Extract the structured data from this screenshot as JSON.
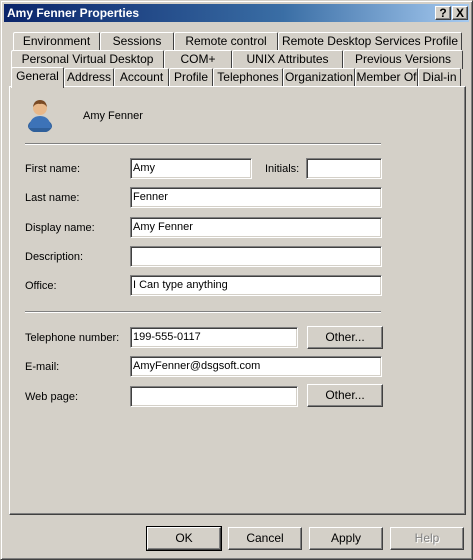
{
  "window": {
    "title": "Amy Fenner Properties",
    "help_button": "?",
    "close_button": "X"
  },
  "tabs": {
    "row1": [
      "Environment",
      "Sessions",
      "Remote control",
      "Remote Desktop Services Profile"
    ],
    "row2": [
      "Personal Virtual Desktop",
      "COM+",
      "UNIX Attributes",
      "Previous Versions"
    ],
    "row3": [
      "General",
      "Address",
      "Account",
      "Profile",
      "Telephones",
      "Organization",
      "Member Of",
      "Dial-in"
    ],
    "active": "General"
  },
  "general": {
    "user_icon": "user-icon",
    "display_heading": "Amy Fenner",
    "first_name_label": "First name:",
    "first_name": "Amy",
    "initials_label": "Initials:",
    "initials": "",
    "last_name_label": "Last name:",
    "last_name": "Fenner",
    "display_name_label": "Display name:",
    "display_name": "Amy Fenner",
    "description_label": "Description:",
    "description": "",
    "office_label": "Office:",
    "office": "I Can type anything",
    "telephone_label": "Telephone number:",
    "telephone": "199-555-0117",
    "email_label": "E-mail:",
    "email": "AmyFenner@dsgsoft.com",
    "webpage_label": "Web page:",
    "webpage": "",
    "other_button": "Other..."
  },
  "footer": {
    "ok": "OK",
    "cancel": "Cancel",
    "apply": "Apply",
    "help": "Help"
  }
}
